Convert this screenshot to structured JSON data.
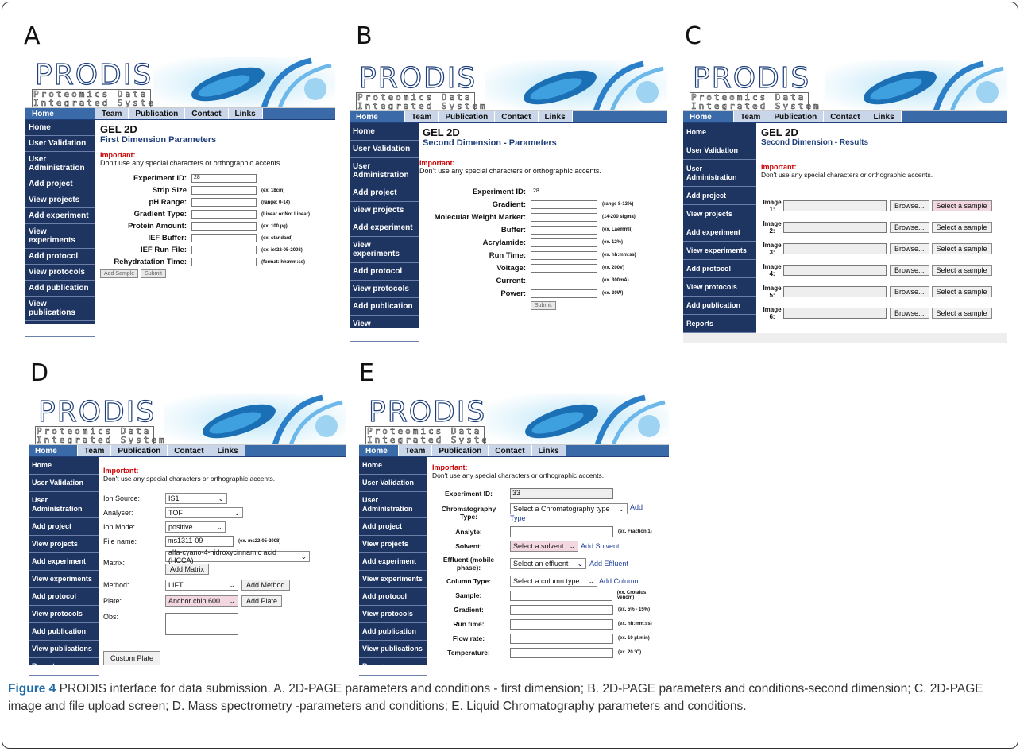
{
  "logo": {
    "big": "PRODIS",
    "sub1": "Proteomics Data",
    "sub2": "Integrated System"
  },
  "nav": {
    "tabs": [
      "Home",
      "Team",
      "Publication",
      "Contact",
      "Links"
    ]
  },
  "sidebar_full": [
    "Home",
    "User Validation",
    "User Administration",
    "Add project",
    "View projects",
    "Add experiment",
    "View experiments",
    "Add protocol",
    "View protocols",
    "Add publication",
    "View publications",
    "Reports"
  ],
  "panels": {
    "A": {
      "letter": "A",
      "title": "GEL 2D",
      "subtitle": "First Dimension Parameters",
      "important": "Important:",
      "warn": "Don't use any special characters or orthographic accents.",
      "fields": [
        {
          "label": "Experiment ID:",
          "value": "28",
          "hint": ""
        },
        {
          "label": "Strip Size",
          "value": "",
          "hint": "(ex. 18cm)"
        },
        {
          "label": "pH Range:",
          "value": "",
          "hint": "(range: 0-14)"
        },
        {
          "label": "Gradient Type:",
          "value": "",
          "hint": "(Linear or Not Linear)"
        },
        {
          "label": "Protein Amount:",
          "value": "",
          "hint": "(ex. 100 µg)"
        },
        {
          "label": "IEF Buffer:",
          "value": "",
          "hint": "(ex. standard)"
        },
        {
          "label": "IEF Run File:",
          "value": "",
          "hint": "(ex. ief22-05-2008)"
        },
        {
          "label": "Rehydratation Time:",
          "value": "",
          "hint": "(format: hh:mm:ss)"
        }
      ],
      "buttons": [
        "Add Sample",
        "Submit"
      ]
    },
    "B": {
      "letter": "B",
      "title": "GEL 2D",
      "subtitle": "Second Dimension - Parameters",
      "important": "Important:",
      "warn": "Don't use any special characters or orthographic accents.",
      "fields": [
        {
          "label": "Experiment ID:",
          "value": "28",
          "hint": ""
        },
        {
          "label": "Gradient:",
          "value": "",
          "hint": "(range 8-13%)"
        },
        {
          "label": "Molecular Weight Marker:",
          "value": "",
          "hint": "(14-200 sigma)"
        },
        {
          "label": "Buffer:",
          "value": "",
          "hint": "(ex. Laemmli)"
        },
        {
          "label": "Acrylamide:",
          "value": "",
          "hint": "(ex. 12%)"
        },
        {
          "label": "Run Time:",
          "value": "",
          "hint": "(ex. hh:mm:ss)"
        },
        {
          "label": "Voltage:",
          "value": "",
          "hint": "(ex. 200V)"
        },
        {
          "label": "Current:",
          "value": "",
          "hint": "(ex. 300mA)"
        },
        {
          "label": "Power:",
          "value": "",
          "hint": "(ex. 30W)"
        }
      ],
      "submit": "Submit"
    },
    "C": {
      "letter": "C",
      "title": "GEL 2D",
      "subtitle": "Second Dimension - Results",
      "important": "Important:",
      "warn": "Don't use any special characters or orthographic accents.",
      "images": [
        "Image 1:",
        "Image 2:",
        "Image 3:",
        "Image 4:",
        "Image 5:",
        "Image 6:"
      ],
      "browse": "Browse...",
      "select": "Select a sample"
    },
    "D": {
      "letter": "D",
      "important": "Important:",
      "warn": "Don't use any special characters or orthographic accents.",
      "ion_source": {
        "label": "Ion Source:",
        "value": "IS1"
      },
      "analyser": {
        "label": "Analyser:",
        "value": "TOF"
      },
      "ion_mode": {
        "label": "Ion Mode:",
        "value": "positive"
      },
      "file_name": {
        "label": "File name:",
        "value": "ms1311-09",
        "hint": "(ex. ms22-05-2008)"
      },
      "matrix": {
        "label": "Matrix:",
        "value": "alfa-cyano-4-hidroxycinnamic acid (HCCA)",
        "button": "Add Matrix"
      },
      "method": {
        "label": "Method:",
        "value": "LIFT",
        "button": "Add Method"
      },
      "plate": {
        "label": "Plate:",
        "value": "Anchor chip 600",
        "button": "Add Plate"
      },
      "obs": {
        "label": "Obs:"
      },
      "custom": "Custom Plate"
    },
    "E": {
      "letter": "E",
      "important": "Important:",
      "warn": "Don't use any special characters or orthographic accents.",
      "exp": {
        "label": "Experiment ID:",
        "value": "33"
      },
      "chrom": {
        "label": "Chromatography Type:",
        "value": "Select a Chromatography type",
        "link1": "Add",
        "link2": "Type"
      },
      "analyte": {
        "label": "Analyte:",
        "hint": "(ex. Fraction 1)"
      },
      "solvent": {
        "label": "Solvent:",
        "value": "Select a solvent",
        "link": "Add Solvent"
      },
      "effluent": {
        "label": "Effluent (mobile phase):",
        "value": "Select an effluent",
        "link": "Add Effluent"
      },
      "column": {
        "label": "Column Type:",
        "value": "Select a column type",
        "link": "Add Column"
      },
      "rest": [
        {
          "label": "Sample:",
          "hint": "(ex. Crotalus venom)"
        },
        {
          "label": "Gradient:",
          "hint": "(ex. 5% - 15%)"
        },
        {
          "label": "Run time:",
          "hint": "(ex. hh:mm:ss)"
        },
        {
          "label": "Flow rate:",
          "hint": "(ex. 10 µl/min)"
        },
        {
          "label": "Temperature:",
          "hint": "(ex. 20 °C)"
        }
      ]
    }
  },
  "caption": {
    "bold": "Figure 4",
    "text": " PRODIS interface for data submission. A. 2D-PAGE parameters and conditions - first dimension; B. 2D-PAGE parameters and conditions-second dimension; C. 2D-PAGE image and file upload screen; D. Mass spectrometry -parameters and conditions; E. Liquid Chromatography parameters and conditions."
  }
}
